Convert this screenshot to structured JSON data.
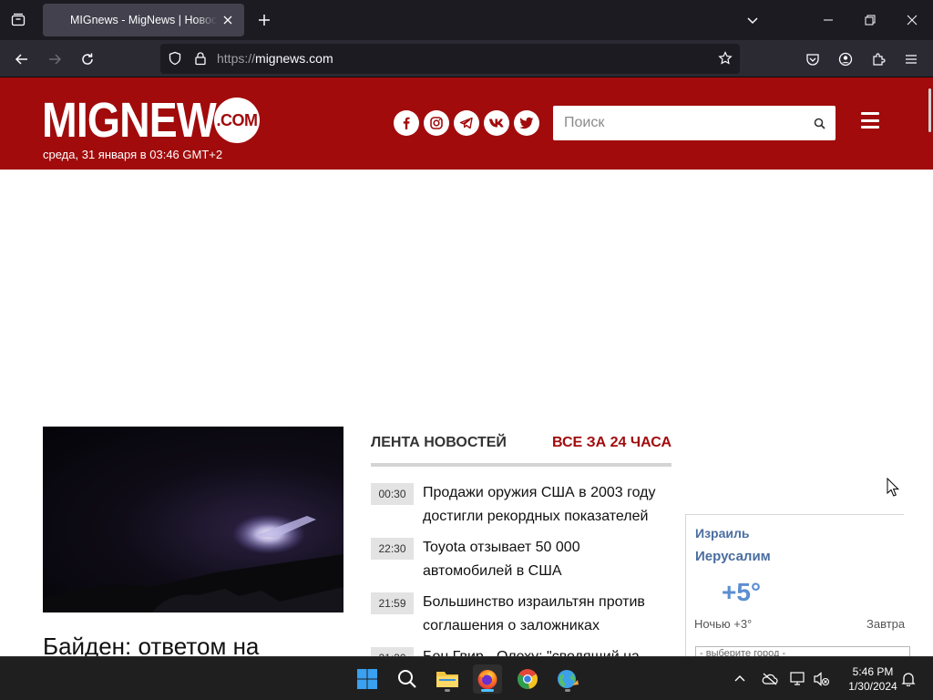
{
  "browser": {
    "tab_title": "MIGnews - MigNews | Новости",
    "url_scheme": "https://",
    "url_host": "mignews.com"
  },
  "site": {
    "logo_text": "MIGNEWS",
    "logo_com": ".COM",
    "date_line": "среда, 31 января в 03:46 GMT+2",
    "search_placeholder": "Поиск",
    "social": [
      "facebook-icon",
      "instagram-icon",
      "telegram-icon",
      "vk-icon",
      "twitter-icon"
    ],
    "brand_color": "#a10b0c"
  },
  "hero": {
    "title": "Байден: ответом на"
  },
  "feed": {
    "label": "ЛЕНТА НОВОСТЕЙ",
    "all_label": "ВСЕ ЗА 24 ЧАСА",
    "items": [
      {
        "time": "00:30",
        "text": "Продажи оружия США в 2003 году достигли рекордных показателей"
      },
      {
        "time": "22:30",
        "text": "Toyota отзывает 50 000 автомобилей в США"
      },
      {
        "time": "21:59",
        "text": "Большинство израильтян против соглашения о заложниках"
      },
      {
        "time": "21:30",
        "text": "Бен Гвир - Олеху: \"сводящий на"
      }
    ]
  },
  "weather": {
    "country": "Израиль",
    "city": "Иерусалим",
    "temp": "+5°",
    "night": "Ночью +3°",
    "tomorrow": "Завтра",
    "select_placeholder": "- выберите город -"
  },
  "taskbar": {
    "time": "5:46 PM",
    "date": "1/30/2024"
  }
}
